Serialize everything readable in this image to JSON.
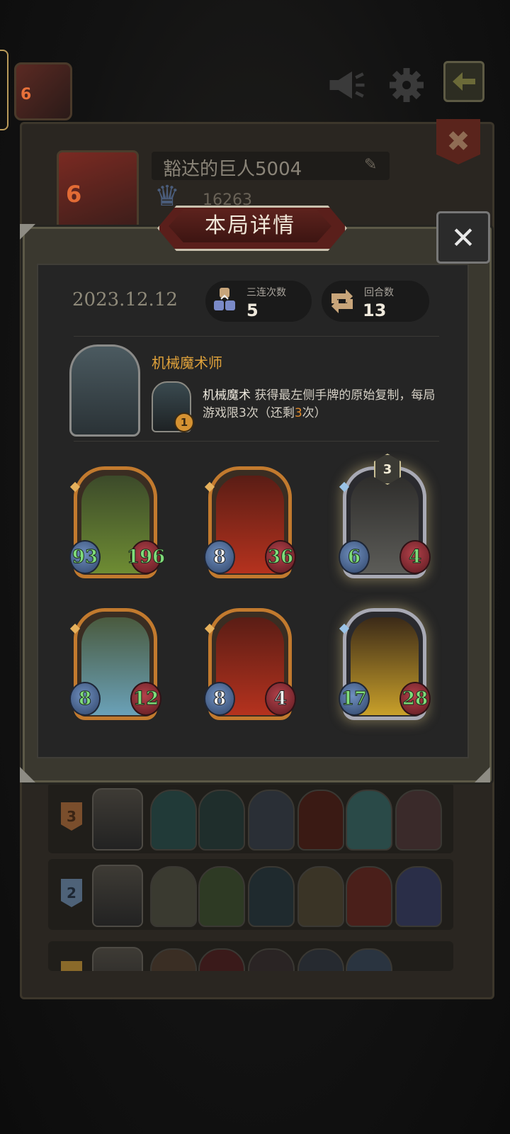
{
  "top_bar": {
    "avatar_level": "6",
    "icons": [
      "megaphone-icon",
      "gear-icon",
      "back-arrow-icon"
    ]
  },
  "profile": {
    "avatar_level": "6",
    "player_name": "豁达的巨人5004",
    "score": "16263",
    "icons": [
      "close-icon",
      "edit-icon",
      "rank-crest-icon"
    ]
  },
  "modal": {
    "title": "本局详情",
    "date": "2023.12.12",
    "stats": [
      {
        "label": "三连次数",
        "value": "5",
        "icon": "triple-icon"
      },
      {
        "label": "回合数",
        "value": "13",
        "icon": "rounds-icon"
      }
    ],
    "hero": {
      "name": "机械魔术师",
      "skill_level": "1",
      "skill_name": "机械魔术",
      "skill_text_1": " 获得最左侧手牌的原始复制，每局游戏限3次（还剩",
      "skill_remaining": "3",
      "skill_text_2": "次）"
    },
    "cards": [
      {
        "name": "green-dragon-card",
        "atk": "93",
        "hp": "196",
        "frame": "gold",
        "atk_color": "green",
        "hp_color": "green",
        "art": [
          "#3c4a2a",
          "#6e8c33"
        ]
      },
      {
        "name": "red-demon-card",
        "atk": "8",
        "hp": "36",
        "frame": "gold",
        "atk_color": "white",
        "hp_color": "green",
        "art": [
          "#5a1d15",
          "#b5321e"
        ]
      },
      {
        "name": "armored-knight-card",
        "atk": "6",
        "hp": "4",
        "frame": "silver",
        "star": "3",
        "atk_color": "green",
        "hp_color": "green",
        "art": [
          "#2e2d2b",
          "#5c5c58"
        ]
      },
      {
        "name": "blue-dragon-card",
        "atk": "8",
        "hp": "12",
        "frame": "gold",
        "atk_color": "green",
        "hp_color": "green",
        "art": [
          "#4a5a3e",
          "#6aa1b8"
        ]
      },
      {
        "name": "red-demon-card-2",
        "atk": "8",
        "hp": "4",
        "frame": "gold",
        "atk_color": "white",
        "hp_color": "white",
        "art": [
          "#5a1d15",
          "#b5321e"
        ]
      },
      {
        "name": "lightning-king-card",
        "atk": "17",
        "hp": "28",
        "frame": "silver",
        "atk_color": "green",
        "hp_color": "green",
        "art": [
          "#3b2a18",
          "#c9a02a"
        ]
      }
    ]
  },
  "history": [
    {
      "rank": "3",
      "badge_color": "#7a4e2c",
      "text_color": "#3a2414",
      "cards": [
        "#213a38",
        "#1f2e2c",
        "#2a2f36",
        "#3a1a14",
        "#2a4a48",
        "#3a2a2a"
      ]
    },
    {
      "rank": "2",
      "badge_color": "#4e6278",
      "text_color": "#1d2733",
      "cards": [
        "#3a3a30",
        "#2e3a24",
        "#1f2a2e",
        "#3a3426",
        "#4a1f1a",
        "#2a2e48"
      ]
    },
    {
      "rank": "",
      "badge_color": "#8a6a2a",
      "text_color": "#3a2a10",
      "cards": [
        "#3a2e24",
        "#3a1a1a",
        "#2a2424",
        "#262a30",
        "#2a3440"
      ]
    }
  ]
}
